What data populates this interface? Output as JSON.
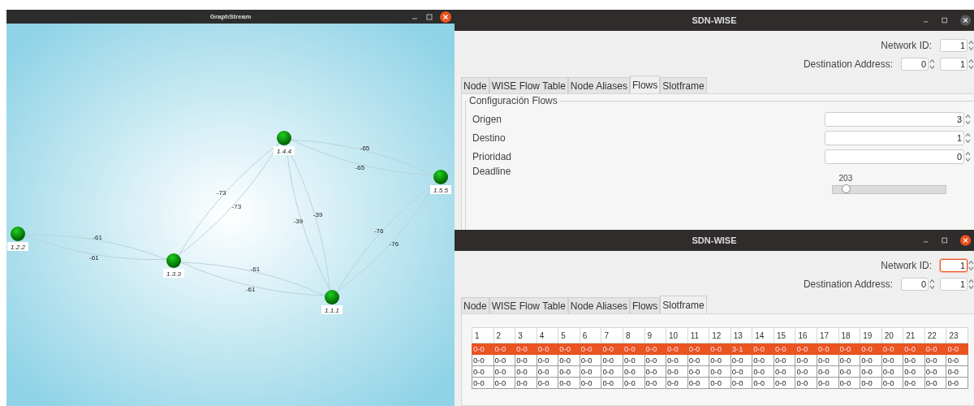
{
  "graph_window": {
    "title": "GraphStream",
    "active": true,
    "nodes": [
      {
        "label": "1.2.2"
      },
      {
        "label": "1.3.3"
      },
      {
        "label": "1.4.4"
      },
      {
        "label": "1.5.5"
      },
      {
        "label": "1.1.1"
      }
    ],
    "edges": [
      {
        "label": "-61"
      },
      {
        "label": "-61"
      },
      {
        "label": "-73"
      },
      {
        "label": "-73"
      },
      {
        "label": "-65"
      },
      {
        "label": "-65"
      },
      {
        "label": "-39"
      },
      {
        "label": "-39"
      },
      {
        "label": "-76"
      },
      {
        "label": "-76"
      },
      {
        "label": "-61"
      },
      {
        "label": "-61"
      }
    ]
  },
  "windows": [
    {
      "title": "SDN-WISE",
      "active": false,
      "kind": "flows",
      "network_id": {
        "label": "Network ID:",
        "value": "1",
        "focused": false
      },
      "destination": {
        "label": "Destination Address:",
        "values": [
          "0",
          "1"
        ]
      },
      "tabs": [
        {
          "label": "Node",
          "selected": false
        },
        {
          "label": "WISE Flow Table",
          "selected": false
        },
        {
          "label": "Node Aliases",
          "selected": false
        },
        {
          "label": "Flows",
          "selected": true
        },
        {
          "label": "Slotframe",
          "selected": false
        }
      ],
      "group": {
        "title": "Configuración Flows",
        "fields": [
          {
            "kind": "spinner",
            "label": "Origen",
            "value": "3"
          },
          {
            "kind": "spinner",
            "label": "Destino",
            "value": "1"
          },
          {
            "kind": "spinner",
            "label": "Prioridad",
            "value": "0"
          },
          {
            "kind": "slider",
            "label": "Deadline",
            "reading": "203",
            "level": 0.12
          }
        ]
      }
    },
    {
      "title": "SDN-WISE",
      "active": true,
      "kind": "slotframe",
      "network_id": {
        "label": "Network ID:",
        "value": "1",
        "focused": true
      },
      "destination": {
        "label": "Destination Address:",
        "values": [
          "0",
          "1"
        ]
      },
      "tabs": [
        {
          "label": "Node",
          "selected": false
        },
        {
          "label": "WISE Flow Table",
          "selected": false
        },
        {
          "label": "Node Aliases",
          "selected": false
        },
        {
          "label": "Flows",
          "selected": false
        },
        {
          "label": "Slotframe",
          "selected": true
        }
      ],
      "table": {
        "columns": [
          "1",
          "2",
          "3",
          "4",
          "5",
          "6",
          "7",
          "8",
          "9",
          "10",
          "11",
          "12",
          "13",
          "14",
          "15",
          "16",
          "17",
          "18",
          "19",
          "20",
          "21",
          "22",
          "23"
        ],
        "rows": [
          {
            "selected": true,
            "cells": [
              "0-0",
              "0-0",
              "0-0",
              "0-0",
              "0-0",
              "0-0",
              "0-0",
              "0-0",
              "0-0",
              "0-0",
              "0-0",
              "0-0",
              "3-1",
              "0-0",
              "0-0",
              "0-0",
              "0-0",
              "0-0",
              "0-0",
              "0-0",
              "0-0",
              "0-0",
              "0-0"
            ]
          },
          {
            "selected": false,
            "cells": [
              "0-0",
              "0-0",
              "0-0",
              "0-0",
              "0-0",
              "0-0",
              "0-0",
              "0-0",
              "0-0",
              "0-0",
              "0-0",
              "0-0",
              "0-0",
              "0-0",
              "0-0",
              "0-0",
              "0-0",
              "0-0",
              "0-0",
              "0-0",
              "0-0",
              "0-0",
              "0-0"
            ]
          },
          {
            "selected": false,
            "cells": [
              "0-0",
              "0-0",
              "0-0",
              "0-0",
              "0-0",
              "0-0",
              "0-0",
              "0-0",
              "0-0",
              "0-0",
              "0-0",
              "0-0",
              "0-0",
              "0-0",
              "0-0",
              "0-0",
              "0-0",
              "0-0",
              "0-0",
              "0-0",
              "0-0",
              "0-0",
              "0-0"
            ]
          },
          {
            "selected": false,
            "cells": [
              "0-0",
              "0-0",
              "0-0",
              "0-0",
              "0-0",
              "0-0",
              "0-0",
              "0-0",
              "0-0",
              "0-0",
              "0-0",
              "0-0",
              "0-0",
              "0-0",
              "0-0",
              "0-0",
              "0-0",
              "0-0",
              "0-0",
              "0-0",
              "0-0",
              "0-0",
              "0-0"
            ]
          }
        ]
      }
    }
  ]
}
